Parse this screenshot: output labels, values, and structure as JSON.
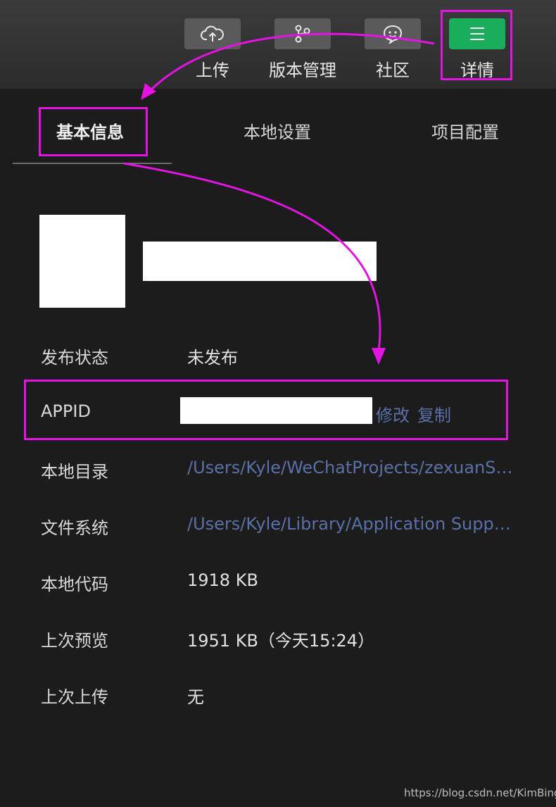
{
  "toolbar": {
    "buttons": [
      {
        "label": "上传",
        "icon": "cloud-upload-icon"
      },
      {
        "label": "版本管理",
        "icon": "branch-icon"
      },
      {
        "label": "社区",
        "icon": "chat-bubble-icon"
      },
      {
        "label": "详情",
        "icon": "menu-lines-icon",
        "active": true
      }
    ]
  },
  "tabs": [
    {
      "label": "基本信息",
      "active": true
    },
    {
      "label": "本地设置"
    },
    {
      "label": "项目配置"
    }
  ],
  "info": {
    "status": {
      "label": "发布状态",
      "value": "未发布"
    },
    "appid": {
      "label": "APPID",
      "edit": "修改",
      "copy": "复制"
    },
    "local_dir": {
      "label": "本地目录",
      "value": "/Users/Kyle/WeChatProjects/zexuanS…"
    },
    "file_system": {
      "label": "文件系统",
      "value": "/Users/Kyle/Library/Application Supp…"
    },
    "local_code": {
      "label": "本地代码",
      "value": "1918 KB"
    },
    "last_preview": {
      "label": "上次预览",
      "value": "1951 KB（今天15:24）"
    },
    "last_upload": {
      "label": "上次上传",
      "value": "无"
    }
  },
  "watermark": "https://blog.csdn.net/KimBing",
  "colors": {
    "background": "#1c1c1c",
    "accent_green": "#1aad5c",
    "link": "#5a70a8",
    "highlight": "#e214e2"
  }
}
